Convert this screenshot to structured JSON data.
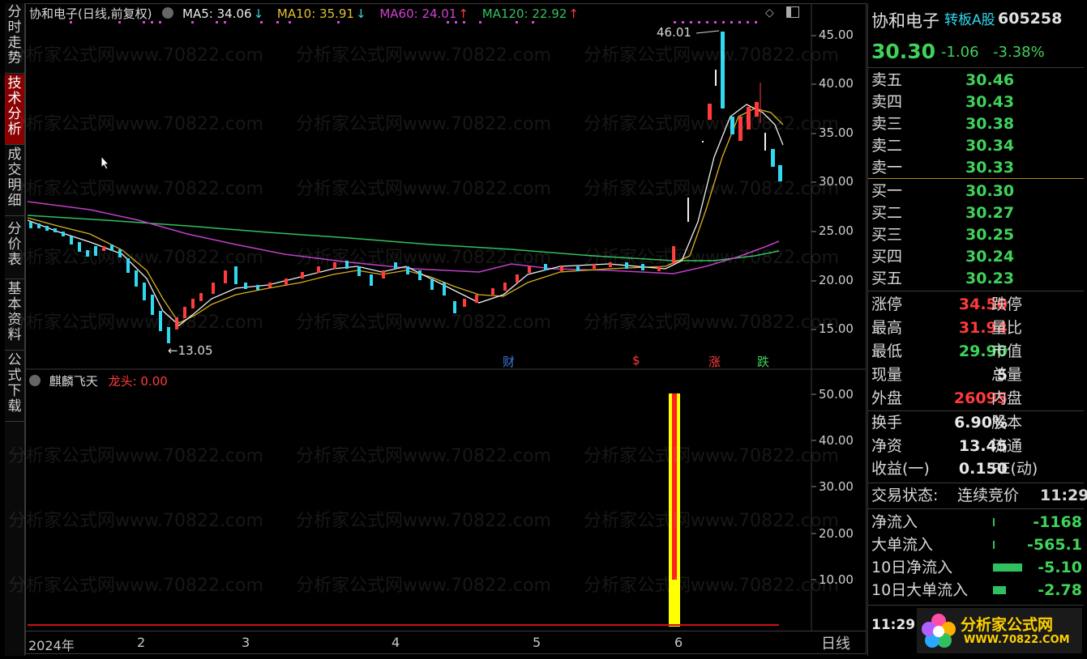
{
  "left_tabs": [
    {
      "label": "分时走势",
      "active": false
    },
    {
      "label": "技术分析",
      "active": true
    },
    {
      "label": "成交明细",
      "active": false
    },
    {
      "label": "分价表",
      "active": false
    },
    {
      "label": "基本资料",
      "active": false
    },
    {
      "label": "公式下载",
      "active": false
    }
  ],
  "main_chart": {
    "title": "协和电子(日线,前复权)",
    "ma_legend": [
      {
        "label": "MA5: 34.06",
        "arrow": "↓",
        "color": "#e8e8e8",
        "arrow_color": "#30d8f0"
      },
      {
        "label": "MA10: 35.91",
        "arrow": "↓",
        "color": "#e0c030",
        "arrow_color": "#30d8f0"
      },
      {
        "label": "MA60: 24.01",
        "arrow": "↑",
        "color": "#d040d0",
        "arrow_color": "#ff3b3b"
      },
      {
        "label": "MA120: 22.92",
        "arrow": "↑",
        "color": "#30c060",
        "arrow_color": "#ff3b3b"
      }
    ],
    "y_axis": [
      "45.00",
      "40.00",
      "35.00",
      "30.00",
      "25.00",
      "20.00",
      "15.00"
    ],
    "high_mark": "46.01",
    "low_mark": "←13.05",
    "event_markers": [
      {
        "label": "财",
        "color": "#3a7adf"
      },
      {
        "label": "$",
        "color": "#ff3b3b"
      },
      {
        "label": "涨",
        "color": "#ff3b3b"
      },
      {
        "label": "跌",
        "color": "#3fd35a"
      }
    ]
  },
  "sub_chart": {
    "title": "麒麟飞天",
    "indicator": "龙头: 0.00",
    "y_axis": [
      "50.00",
      "40.00",
      "30.00",
      "20.00",
      "10.00"
    ]
  },
  "x_axis": {
    "labels": [
      "2024年",
      "2",
      "3",
      "4",
      "5",
      "6"
    ],
    "period": "日线"
  },
  "watermark_text": "分析家公式网www.70822.com",
  "quote": {
    "name": "协和电子",
    "board": "转板A股",
    "code": "605258",
    "price": "30.30",
    "change": "-1.06",
    "change_pct": "-3.38%",
    "asks": [
      {
        "label": "卖五",
        "price": "30.46"
      },
      {
        "label": "卖四",
        "price": "30.43"
      },
      {
        "label": "卖三",
        "price": "30.38"
      },
      {
        "label": "卖二",
        "price": "30.34"
      },
      {
        "label": "卖一",
        "price": "30.33"
      }
    ],
    "bids": [
      {
        "label": "买一",
        "price": "30.30"
      },
      {
        "label": "买二",
        "price": "30.27"
      },
      {
        "label": "买三",
        "price": "30.25"
      },
      {
        "label": "买四",
        "price": "30.24"
      },
      {
        "label": "买五",
        "price": "30.23"
      }
    ],
    "stats1": [
      {
        "label": "涨停",
        "value": "34.50",
        "color": "red",
        "label2": "跌停"
      },
      {
        "label": "最高",
        "value": "31.94",
        "color": "red",
        "label2": "量比"
      },
      {
        "label": "最低",
        "value": "29.90",
        "color": "green",
        "label2": "市值"
      },
      {
        "label": "现量",
        "value": "5",
        "color": "white",
        "label2": "总量"
      },
      {
        "label": "外盘",
        "value": "26095",
        "color": "red",
        "label2": "内盘"
      }
    ],
    "stats2": [
      {
        "label": "换手",
        "value": "6.90%",
        "label2": "股本"
      },
      {
        "label": "净资",
        "value": "13.45",
        "label2": "流通"
      },
      {
        "label": "收益(一)",
        "value": "0.150",
        "label2": "PE(动)"
      }
    ],
    "trade_status_label": "交易状态:",
    "trade_status": "连续竞价",
    "trade_time": "11:29",
    "flows": [
      {
        "label": "净流入",
        "value": "-1168",
        "bar": 0.02
      },
      {
        "label": "大单流入",
        "value": "-565.1",
        "bar": 0.02
      },
      {
        "label": "10日净流入",
        "value": "-5.10",
        "bar": 0.9
      },
      {
        "label": "10日大单流入",
        "value": "-2.78",
        "bar": 0.4
      }
    ],
    "footer_time": "11:29",
    "logo_text": "分析家公式网",
    "logo_url_text": "WWW.70822.COM"
  }
}
